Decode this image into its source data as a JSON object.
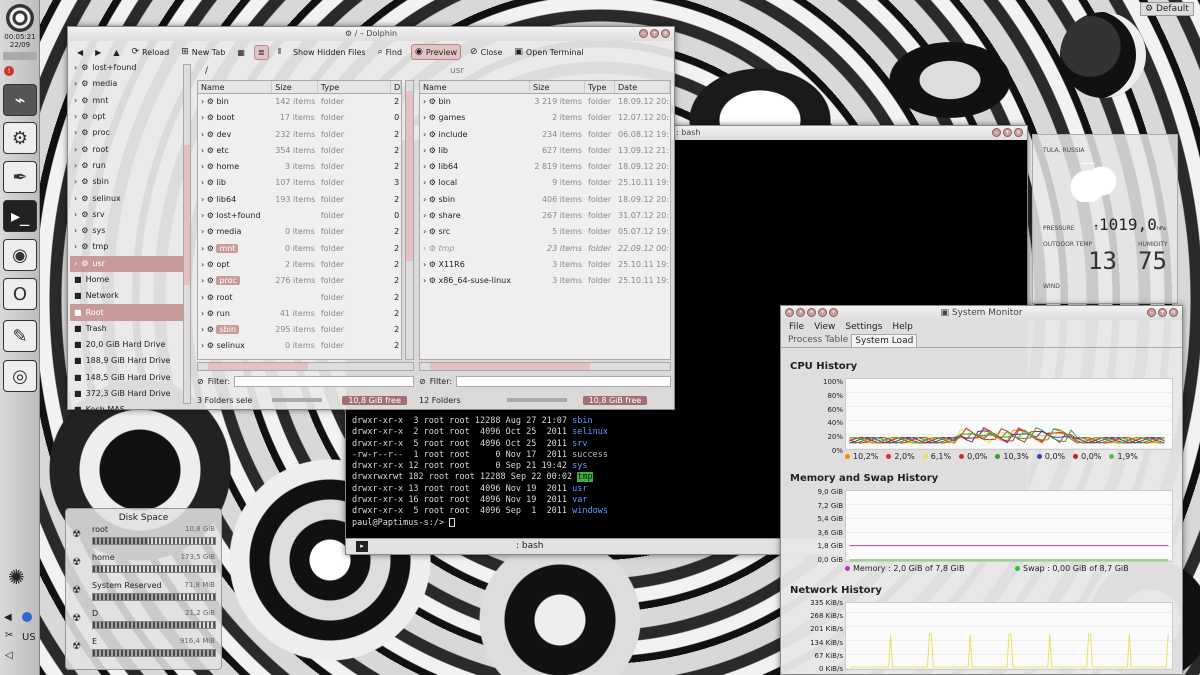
{
  "panel": {
    "time": "00:05:21",
    "date": "22/09",
    "layout": "US",
    "top_right_label": "Default"
  },
  "dolphin": {
    "title": "/ – Dolphin",
    "toolbar": {
      "reload": "Reload",
      "new_tab": "New Tab",
      "show_hidden": "Show Hidden Files",
      "find": "Find",
      "preview": "Preview",
      "close": "Close",
      "terminal": "Open Terminal"
    },
    "left_path": "/",
    "right_path": "usr",
    "places": [
      {
        "name": "lost+found"
      },
      {
        "name": "media"
      },
      {
        "name": "mnt"
      },
      {
        "name": "opt"
      },
      {
        "name": "proc"
      },
      {
        "name": "root"
      },
      {
        "name": "run"
      },
      {
        "name": "sbin"
      },
      {
        "name": "selinux"
      },
      {
        "name": "srv"
      },
      {
        "name": "sys"
      },
      {
        "name": "tmp"
      },
      {
        "name": "usr"
      },
      {
        "name": "Home"
      },
      {
        "name": "Network"
      },
      {
        "name": "Root"
      },
      {
        "name": "Trash"
      },
      {
        "name": "20,0 GiB Hard Drive"
      },
      {
        "name": "188,9 GiB Hard Drive"
      },
      {
        "name": "148,5 GiB Hard Drive"
      },
      {
        "name": "372,3 GiB Hard Drive"
      },
      {
        "name": "Koch MAS"
      }
    ],
    "columns": {
      "name": "Name",
      "size": "Size",
      "type": "Type",
      "date": "Date"
    },
    "left_rows": [
      {
        "name": "bin",
        "size": "142 items",
        "type": "folder",
        "x": "2"
      },
      {
        "name": "boot",
        "size": "17 items",
        "type": "folder",
        "x": "0"
      },
      {
        "name": "dev",
        "size": "232 items",
        "type": "folder",
        "x": "2"
      },
      {
        "name": "etc",
        "size": "354 items",
        "type": "folder",
        "x": "2"
      },
      {
        "name": "home",
        "size": "3 items",
        "type": "folder",
        "x": "2"
      },
      {
        "name": "lib",
        "size": "107 items",
        "type": "folder",
        "x": "3"
      },
      {
        "name": "lib64",
        "size": "193 items",
        "type": "folder",
        "x": "2"
      },
      {
        "name": "lost+found",
        "size": "",
        "type": "folder",
        "x": "0"
      },
      {
        "name": "media",
        "size": "0 items",
        "type": "folder",
        "x": "2"
      },
      {
        "name": "mnt",
        "size": "0 items",
        "type": "folder",
        "x": "2"
      },
      {
        "name": "opt",
        "size": "2 items",
        "type": "folder",
        "x": "2"
      },
      {
        "name": "proc",
        "size": "276 items",
        "type": "folder",
        "x": "2"
      },
      {
        "name": "root",
        "size": "",
        "type": "folder",
        "x": "2"
      },
      {
        "name": "run",
        "size": "41 items",
        "type": "folder",
        "x": "2"
      },
      {
        "name": "sbin",
        "size": "295 items",
        "type": "folder",
        "x": "2"
      },
      {
        "name": "selinux",
        "size": "0 items",
        "type": "folder",
        "x": "2"
      }
    ],
    "right_rows": [
      {
        "name": "bin",
        "size": "3 219 items",
        "type": "folder",
        "date": "18.09.12 20:"
      },
      {
        "name": "games",
        "size": "2 items",
        "type": "folder",
        "date": "12.07.12 20:"
      },
      {
        "name": "include",
        "size": "234 items",
        "type": "folder",
        "date": "06.08.12 19:"
      },
      {
        "name": "lib",
        "size": "627 items",
        "type": "folder",
        "date": "13.09.12 21:"
      },
      {
        "name": "lib64",
        "size": "2 819 items",
        "type": "folder",
        "date": "18.09.12 20:"
      },
      {
        "name": "local",
        "size": "9 items",
        "type": "folder",
        "date": "25.10.11 19:"
      },
      {
        "name": "sbin",
        "size": "406 items",
        "type": "folder",
        "date": "18.09.12 20:"
      },
      {
        "name": "share",
        "size": "267 items",
        "type": "folder",
        "date": "31.07.12 20:"
      },
      {
        "name": "src",
        "size": "5 items",
        "type": "folder",
        "date": "05.07.12 19:"
      },
      {
        "name": "tmp",
        "size": "23 items",
        "type": "folder",
        "date": "22.09.12 00:"
      },
      {
        "name": "X11R6",
        "size": "3 items",
        "type": "folder",
        "date": "25.10.11 19:"
      },
      {
        "name": "x86_64-suse-linux",
        "size": "3 items",
        "type": "folder",
        "date": "25.10.11 19:"
      }
    ],
    "filter_label": "Filter:",
    "left_status": "3 Folders sele",
    "right_status": "12 Folders",
    "free_left": "10,8 GiB free",
    "free_right": "10,8 GiB free"
  },
  "terminal": {
    "title": ": bash",
    "tab_label": ": bash",
    "lines": [
      {
        "perm": "drwxr-xr-x",
        "n": " 3",
        "u": "root",
        "g": "root",
        "sz": "12288",
        "date": "Aug 27 21:07",
        "name": "sbin",
        "c": "#5a9cff"
      },
      {
        "perm": "drwxr-xr-x",
        "n": " 2",
        "u": "root",
        "g": "root",
        "sz": " 4096",
        "date": "Oct 25  2011",
        "name": "selinux",
        "c": "#5a9cff"
      },
      {
        "perm": "drwxr-xr-x",
        "n": " 5",
        "u": "root",
        "g": "root",
        "sz": " 4096",
        "date": "Oct 25  2011",
        "name": "srv",
        "c": "#5a9cff"
      },
      {
        "perm": "-rw-r--r--",
        "n": " 1",
        "u": "root",
        "g": "root",
        "sz": "    0",
        "date": "Nov 17  2011",
        "name": "success",
        "c": "#bbbbbb"
      },
      {
        "perm": "drwxr-xr-x",
        "n": "12",
        "u": "root",
        "g": "root",
        "sz": "    0",
        "date": "Sep 21 19:42",
        "name": "sys",
        "c": "#5a9cff"
      },
      {
        "perm": "drwxrwxrwt",
        "n": "182",
        "u": "root",
        "g": "root",
        "sz": "12288",
        "date": "Sep 22 00:02",
        "name": "tmp",
        "c": "#111",
        "bg": "#3bb33b"
      },
      {
        "perm": "drwxr-xr-x",
        "n": "13",
        "u": "root",
        "g": "root",
        "sz": " 4096",
        "date": "Nov 19  2011",
        "name": "usr",
        "c": "#5a9cff"
      },
      {
        "perm": "drwxr-xr-x",
        "n": "16",
        "u": "root",
        "g": "root",
        "sz": " 4096",
        "date": "Nov 19  2011",
        "name": "var",
        "c": "#5a9cff"
      },
      {
        "perm": "drwxr-xr-x",
        "n": " 5",
        "u": "root",
        "g": "root",
        "sz": " 4096",
        "date": "Sep  1  2011",
        "name": "windows",
        "c": "#5a9cff"
      }
    ],
    "prompt": "paul@Paptimus-s:/> "
  },
  "weather": {
    "location": "TULA, RUSSIA",
    "pressure_label": "PRESSURE",
    "pressure": "1019,0",
    "pressure_unit": "hPa",
    "temp_label": "OUTDOOR TEMP",
    "temp": "13",
    "humidity_label": "HUMIDITY",
    "humidity": "75",
    "wind_label": "WIND"
  },
  "sysmon": {
    "title": "System Monitor",
    "menu": {
      "file": "File",
      "view": "View",
      "settings": "Settings",
      "help": "Help"
    },
    "tabs": {
      "process": "Process Table",
      "load": "System Load"
    },
    "cpu": {
      "title": "CPU History",
      "yticks": [
        "100%",
        "80%",
        "60%",
        "40%",
        "20%",
        "0%"
      ],
      "legend": [
        {
          "v": "10,2%",
          "c": "#ff8c00"
        },
        {
          "v": "2,0%",
          "c": "#e03030"
        },
        {
          "v": "6,1%",
          "c": "#e8e050"
        },
        {
          "v": "0,0%",
          "c": "#c03030"
        },
        {
          "v": "10,3%",
          "c": "#30a030"
        },
        {
          "v": "0,0%",
          "c": "#3040c0"
        },
        {
          "v": "0,0%",
          "c": "#d02020"
        },
        {
          "v": "1,9%",
          "c": "#50c050"
        }
      ]
    },
    "mem": {
      "title": "Memory and Swap History",
      "yticks": [
        "9,0 GiB",
        "7,2 GiB",
        "5,4 GiB",
        "3,6 GiB",
        "1,8 GiB",
        "0,0 GiB"
      ],
      "memory": "Memory : 2,0 GiB of 7,8 GiB",
      "swap": "Swap : 0,00 GiB of 8,7 GiB",
      "mem_color": "#c030c0",
      "swap_color": "#30c030"
    },
    "net": {
      "title": "Network History",
      "yticks": [
        "335 KiB/s",
        "268 KiB/s",
        "201 KiB/s",
        "134 KiB/s",
        "67 KiB/s",
        "0 KiB/s"
      ]
    }
  },
  "disk": {
    "title": "Disk Space",
    "items": [
      {
        "name": "root",
        "size": "10,8 GiB",
        "used": 0.45
      },
      {
        "name": "home",
        "size": "173,5 GiB",
        "used": 0.08
      },
      {
        "name": "System Reserved",
        "size": "71,8 MiB",
        "used": 0.7
      },
      {
        "name": "D",
        "size": "21,2 GiB",
        "used": 0.85
      },
      {
        "name": "E",
        "size": "916,4 MiB",
        "used": 0.995
      }
    ]
  }
}
